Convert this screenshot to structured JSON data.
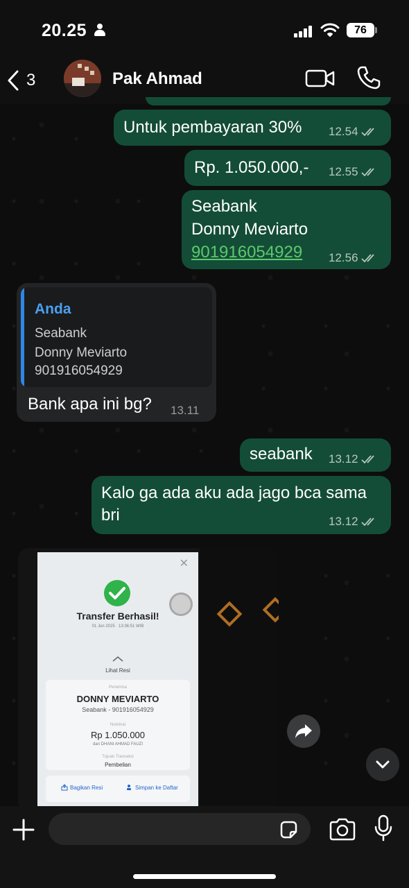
{
  "status_bar": {
    "time": "20.25",
    "battery": "76"
  },
  "header": {
    "back_count": "3",
    "contact_name": "Pak Ahmad"
  },
  "messages": [
    {
      "direction": "out",
      "text": "Untuk pembayaran 30%",
      "time": "12.54"
    },
    {
      "direction": "out",
      "text": "Rp. 1.050.000,-",
      "time": "12.55"
    },
    {
      "direction": "out",
      "lines": [
        "Seabank",
        "Donny Meviarto"
      ],
      "link": "901916054929",
      "time": "12.56"
    },
    {
      "direction": "in",
      "quote": {
        "author": "Anda",
        "lines": [
          "Seabank",
          "Donny Meviarto",
          "901916054929"
        ]
      },
      "text": "Bank apa ini bg?",
      "time": "13.11"
    },
    {
      "direction": "out",
      "text": "seabank",
      "time": "13.12"
    },
    {
      "direction": "out",
      "lines": [
        "Kalo ga ada aku ada jago bca sama",
        "bri"
      ],
      "time": "13.12"
    }
  ],
  "image_message": {
    "screenshot": {
      "title": "Transfer Berhasil!",
      "date": "01 Jun 2025 · 13:36:51 WIB",
      "receipt_link": "Lihat Resi",
      "recipient_label": "Penerima",
      "recipient_name": "DONNY MEVIARTO",
      "recipient_account": "Seabank - 901916054929",
      "amount_label": "Nominal",
      "amount": "Rp 1.050.000",
      "sender": "dari DHANI AHMAD FAUZI",
      "purpose_label": "Tujuan Transaksi",
      "purpose": "Pembelian",
      "share_label": "Bagikan Resi",
      "save_label": "Simpan ke Daftar"
    }
  },
  "input": {
    "placeholder": ""
  },
  "colors": {
    "outgoing_bubble": "#144d37",
    "incoming_bubble": "#232425",
    "link": "#5bc96e",
    "quote_accent": "#2f86e8",
    "background": "#0d0d0d"
  },
  "icons": [
    "person-icon",
    "signal-icon",
    "wifi-icon",
    "battery-icon",
    "back-chevron-icon",
    "video-call-icon",
    "phone-call-icon",
    "double-check-icon",
    "forward-icon",
    "chevron-down-icon",
    "plus-icon",
    "sticker-icon",
    "camera-icon",
    "microphone-icon"
  ]
}
